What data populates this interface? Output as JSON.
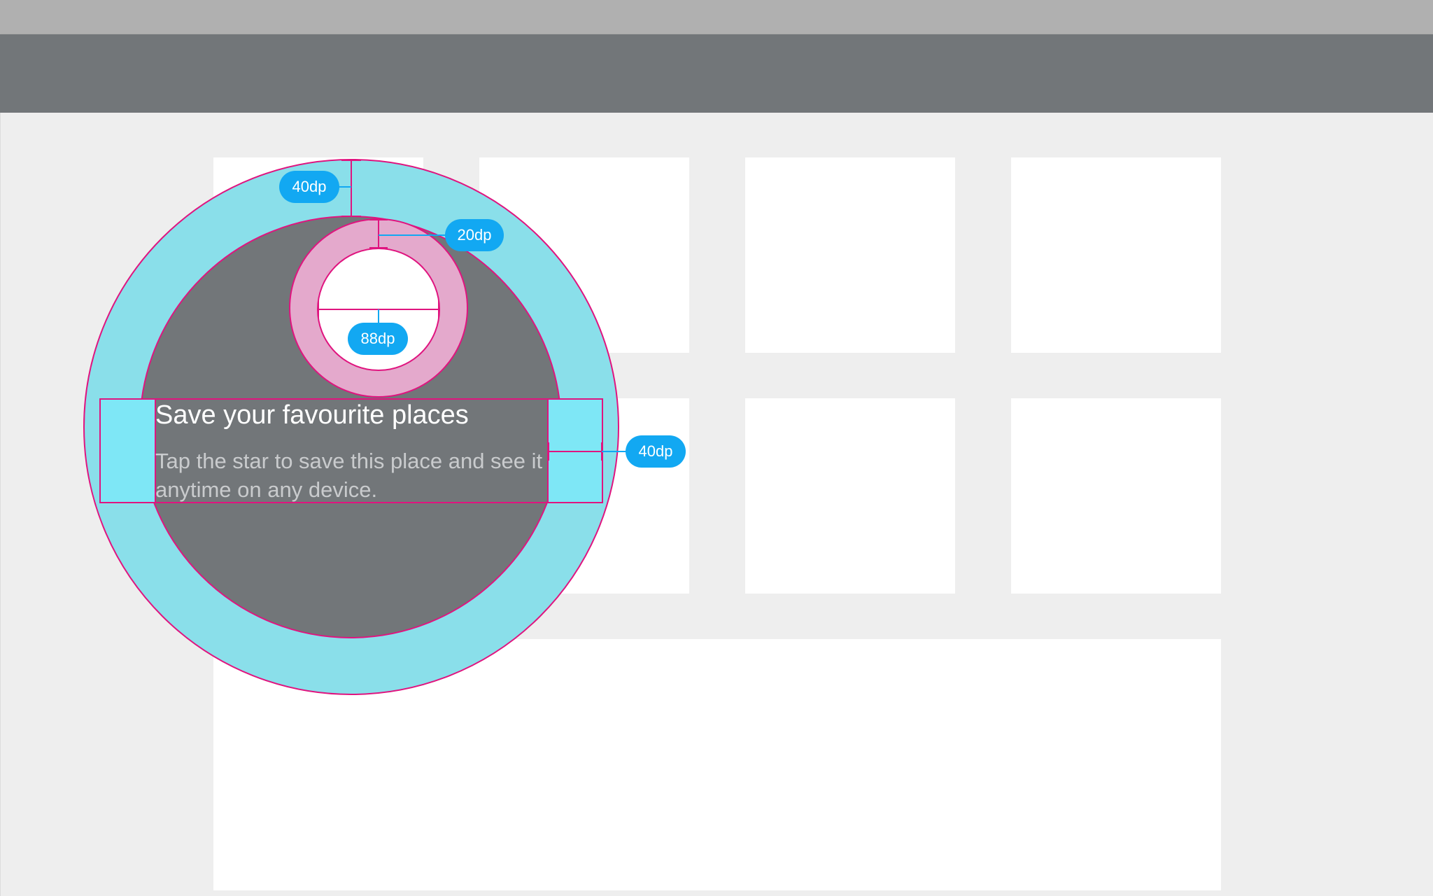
{
  "feature_discovery": {
    "title": "Save your favourite places",
    "body": "Tap the star to save this place and see it anytime on any device."
  },
  "measurements": {
    "outer_ring_width": "40dp",
    "target_padding": "20dp",
    "target_diameter": "88dp",
    "text_side_padding": "40dp"
  },
  "colors": {
    "status_bar": "#b0b0b0",
    "app_bar": "#727679",
    "background": "#eeeeee",
    "outer_circle": "#8adfea",
    "inner_circle": "#727679",
    "target_ring": "#e4a9cc",
    "spec_line": "#e0147f",
    "badge": "#12a8f2"
  }
}
